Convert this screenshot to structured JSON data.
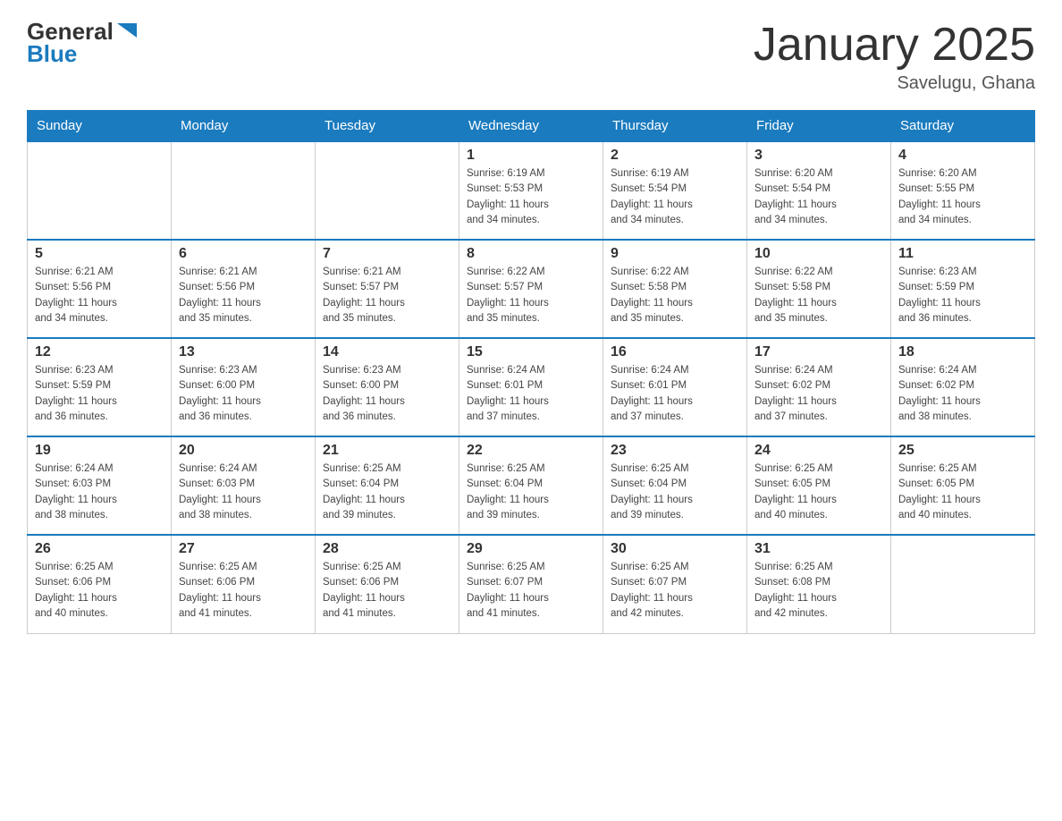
{
  "header": {
    "logo": {
      "text1": "General",
      "arrow": "▶",
      "text2": "Blue"
    },
    "title": "January 2025",
    "subtitle": "Savelugu, Ghana"
  },
  "days_of_week": [
    "Sunday",
    "Monday",
    "Tuesday",
    "Wednesday",
    "Thursday",
    "Friday",
    "Saturday"
  ],
  "weeks": [
    {
      "days": [
        {
          "num": "",
          "info": ""
        },
        {
          "num": "",
          "info": ""
        },
        {
          "num": "",
          "info": ""
        },
        {
          "num": "1",
          "info": "Sunrise: 6:19 AM\nSunset: 5:53 PM\nDaylight: 11 hours\nand 34 minutes."
        },
        {
          "num": "2",
          "info": "Sunrise: 6:19 AM\nSunset: 5:54 PM\nDaylight: 11 hours\nand 34 minutes."
        },
        {
          "num": "3",
          "info": "Sunrise: 6:20 AM\nSunset: 5:54 PM\nDaylight: 11 hours\nand 34 minutes."
        },
        {
          "num": "4",
          "info": "Sunrise: 6:20 AM\nSunset: 5:55 PM\nDaylight: 11 hours\nand 34 minutes."
        }
      ]
    },
    {
      "days": [
        {
          "num": "5",
          "info": "Sunrise: 6:21 AM\nSunset: 5:56 PM\nDaylight: 11 hours\nand 34 minutes."
        },
        {
          "num": "6",
          "info": "Sunrise: 6:21 AM\nSunset: 5:56 PM\nDaylight: 11 hours\nand 35 minutes."
        },
        {
          "num": "7",
          "info": "Sunrise: 6:21 AM\nSunset: 5:57 PM\nDaylight: 11 hours\nand 35 minutes."
        },
        {
          "num": "8",
          "info": "Sunrise: 6:22 AM\nSunset: 5:57 PM\nDaylight: 11 hours\nand 35 minutes."
        },
        {
          "num": "9",
          "info": "Sunrise: 6:22 AM\nSunset: 5:58 PM\nDaylight: 11 hours\nand 35 minutes."
        },
        {
          "num": "10",
          "info": "Sunrise: 6:22 AM\nSunset: 5:58 PM\nDaylight: 11 hours\nand 35 minutes."
        },
        {
          "num": "11",
          "info": "Sunrise: 6:23 AM\nSunset: 5:59 PM\nDaylight: 11 hours\nand 36 minutes."
        }
      ]
    },
    {
      "days": [
        {
          "num": "12",
          "info": "Sunrise: 6:23 AM\nSunset: 5:59 PM\nDaylight: 11 hours\nand 36 minutes."
        },
        {
          "num": "13",
          "info": "Sunrise: 6:23 AM\nSunset: 6:00 PM\nDaylight: 11 hours\nand 36 minutes."
        },
        {
          "num": "14",
          "info": "Sunrise: 6:23 AM\nSunset: 6:00 PM\nDaylight: 11 hours\nand 36 minutes."
        },
        {
          "num": "15",
          "info": "Sunrise: 6:24 AM\nSunset: 6:01 PM\nDaylight: 11 hours\nand 37 minutes."
        },
        {
          "num": "16",
          "info": "Sunrise: 6:24 AM\nSunset: 6:01 PM\nDaylight: 11 hours\nand 37 minutes."
        },
        {
          "num": "17",
          "info": "Sunrise: 6:24 AM\nSunset: 6:02 PM\nDaylight: 11 hours\nand 37 minutes."
        },
        {
          "num": "18",
          "info": "Sunrise: 6:24 AM\nSunset: 6:02 PM\nDaylight: 11 hours\nand 38 minutes."
        }
      ]
    },
    {
      "days": [
        {
          "num": "19",
          "info": "Sunrise: 6:24 AM\nSunset: 6:03 PM\nDaylight: 11 hours\nand 38 minutes."
        },
        {
          "num": "20",
          "info": "Sunrise: 6:24 AM\nSunset: 6:03 PM\nDaylight: 11 hours\nand 38 minutes."
        },
        {
          "num": "21",
          "info": "Sunrise: 6:25 AM\nSunset: 6:04 PM\nDaylight: 11 hours\nand 39 minutes."
        },
        {
          "num": "22",
          "info": "Sunrise: 6:25 AM\nSunset: 6:04 PM\nDaylight: 11 hours\nand 39 minutes."
        },
        {
          "num": "23",
          "info": "Sunrise: 6:25 AM\nSunset: 6:04 PM\nDaylight: 11 hours\nand 39 minutes."
        },
        {
          "num": "24",
          "info": "Sunrise: 6:25 AM\nSunset: 6:05 PM\nDaylight: 11 hours\nand 40 minutes."
        },
        {
          "num": "25",
          "info": "Sunrise: 6:25 AM\nSunset: 6:05 PM\nDaylight: 11 hours\nand 40 minutes."
        }
      ]
    },
    {
      "days": [
        {
          "num": "26",
          "info": "Sunrise: 6:25 AM\nSunset: 6:06 PM\nDaylight: 11 hours\nand 40 minutes."
        },
        {
          "num": "27",
          "info": "Sunrise: 6:25 AM\nSunset: 6:06 PM\nDaylight: 11 hours\nand 41 minutes."
        },
        {
          "num": "28",
          "info": "Sunrise: 6:25 AM\nSunset: 6:06 PM\nDaylight: 11 hours\nand 41 minutes."
        },
        {
          "num": "29",
          "info": "Sunrise: 6:25 AM\nSunset: 6:07 PM\nDaylight: 11 hours\nand 41 minutes."
        },
        {
          "num": "30",
          "info": "Sunrise: 6:25 AM\nSunset: 6:07 PM\nDaylight: 11 hours\nand 42 minutes."
        },
        {
          "num": "31",
          "info": "Sunrise: 6:25 AM\nSunset: 6:08 PM\nDaylight: 11 hours\nand 42 minutes."
        },
        {
          "num": "",
          "info": ""
        }
      ]
    }
  ]
}
